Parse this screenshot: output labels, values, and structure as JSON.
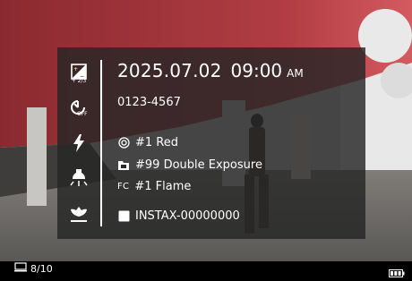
{
  "overlay": {
    "date": "2025.07.02",
    "time": "09:00",
    "ampm": "AM",
    "serial": "0123-4567",
    "settings": [
      {
        "icon": "lens-icon",
        "label": "#1 Red"
      },
      {
        "icon": "film-folder-icon",
        "label": "#99 Double Exposure"
      },
      {
        "tag": "FC",
        "label": "#1 Flame"
      }
    ],
    "device_name": "INSTAX-00000000",
    "icons": {
      "exposure": {
        "name": "exposure-compensation-icon",
        "value": "+ 2/3"
      },
      "self_timer": {
        "name": "self-timer-off-icon",
        "value": "OFF"
      },
      "flash": {
        "name": "flash-icon"
      },
      "lamp": {
        "name": "lamp-icon"
      },
      "macro": {
        "name": "macro-icon"
      }
    }
  },
  "status": {
    "count": "8/10",
    "print_icon": "print-icon",
    "battery_icon": "battery-full-icon"
  }
}
